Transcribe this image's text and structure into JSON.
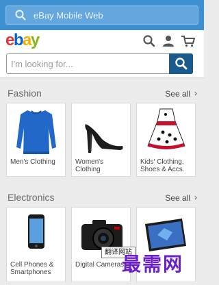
{
  "browser": {
    "url_text": "eBay Mobile Web"
  },
  "header": {
    "icons": [
      "search-icon",
      "user-icon",
      "cart-icon"
    ]
  },
  "search": {
    "placeholder": "I'm looking for..."
  },
  "sections": [
    {
      "title": "Fashion",
      "see_all": "See all",
      "items": [
        "Men's Clothing",
        "Women's Clothing",
        "Kids' Clothing, Shoes & Accs."
      ]
    },
    {
      "title": "Electronics",
      "see_all": "See all",
      "items": [
        "Cell Phones & Smartphones",
        "Digital Cameras",
        ""
      ]
    }
  ],
  "overlay": {
    "tooltip": "翻译网站",
    "watermark": "最需网"
  },
  "colors": {
    "browser_bar": "#3d8fcf",
    "search_button": "#1b5a8c",
    "background": "#ececec"
  }
}
